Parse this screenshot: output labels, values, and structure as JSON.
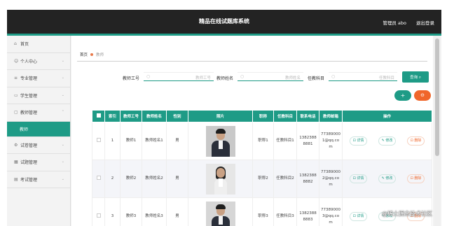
{
  "header": {
    "title": "精品在线试题库系统",
    "user": "管理员 abo",
    "logout": "退出登录"
  },
  "sidebar": {
    "items": [
      {
        "label": "首页",
        "icon": "home-icon",
        "glyph": "⌂",
        "chev": ""
      },
      {
        "label": "个人中心",
        "icon": "user-icon",
        "glyph": "☺",
        "chev": "⌄"
      },
      {
        "label": "专业管理",
        "icon": "list-icon",
        "glyph": "≡",
        "chev": "⌄"
      },
      {
        "label": "学生管理",
        "icon": "monitor-icon",
        "glyph": "▭",
        "chev": "⌄"
      },
      {
        "label": "教师管理",
        "icon": "chat-icon",
        "glyph": "▢",
        "chev": "⌃"
      }
    ],
    "sub": {
      "label": "教师"
    },
    "items2": [
      {
        "label": "试卷管理",
        "icon": "gear-icon",
        "glyph": "⚙",
        "chev": "⌄"
      },
      {
        "label": "试题管理",
        "icon": "grid-icon",
        "glyph": "▦",
        "chev": "⌄"
      },
      {
        "label": "考试管理",
        "icon": "doc-icon",
        "glyph": "▤",
        "chev": "⌄"
      }
    ]
  },
  "breadcrumb": {
    "home": "首页",
    "current": "教师"
  },
  "search": {
    "f1_label": "教师工号",
    "f1_placeholder": "教师工号",
    "f2_label": "教师姓名",
    "f2_placeholder": "教师姓名",
    "f3_label": "任教科目",
    "f3_placeholder": "任教科目",
    "button": "查询 ⌕"
  },
  "actions": {
    "add": "+",
    "delete": "⊖"
  },
  "table": {
    "headers": [
      "索引",
      "教师工号",
      "教师姓名",
      "性别",
      "照片",
      "职称",
      "任教科目",
      "联系电话",
      "教师邮箱",
      "操作"
    ],
    "rows": [
      {
        "index": "1",
        "id": "教师1",
        "name": "教师姓名1",
        "gender": "男",
        "title": "职称1",
        "subject": "任教科目1",
        "phone": "13823888881",
        "email": "773890001@qq.com"
      },
      {
        "index": "2",
        "id": "教师2",
        "name": "教师姓名2",
        "gender": "男",
        "title": "职称2",
        "subject": "任教科目2",
        "phone": "13823888882",
        "email": "773890002@qq.com"
      },
      {
        "index": "3",
        "id": "教师3",
        "name": "教师姓名3",
        "gender": "男",
        "title": "职称3",
        "subject": "任教科目3",
        "phone": "13823888883",
        "email": "773890003@qq.com"
      }
    ],
    "ops": {
      "detail": "⊡ 详情",
      "edit": "✎ 修改",
      "delete": "⊡ 删除"
    }
  },
  "watermark": "@稀土掘金技术社区",
  "colors": {
    "accent": "#1e9b86",
    "danger": "#f0662a",
    "topbar": "#232323"
  }
}
